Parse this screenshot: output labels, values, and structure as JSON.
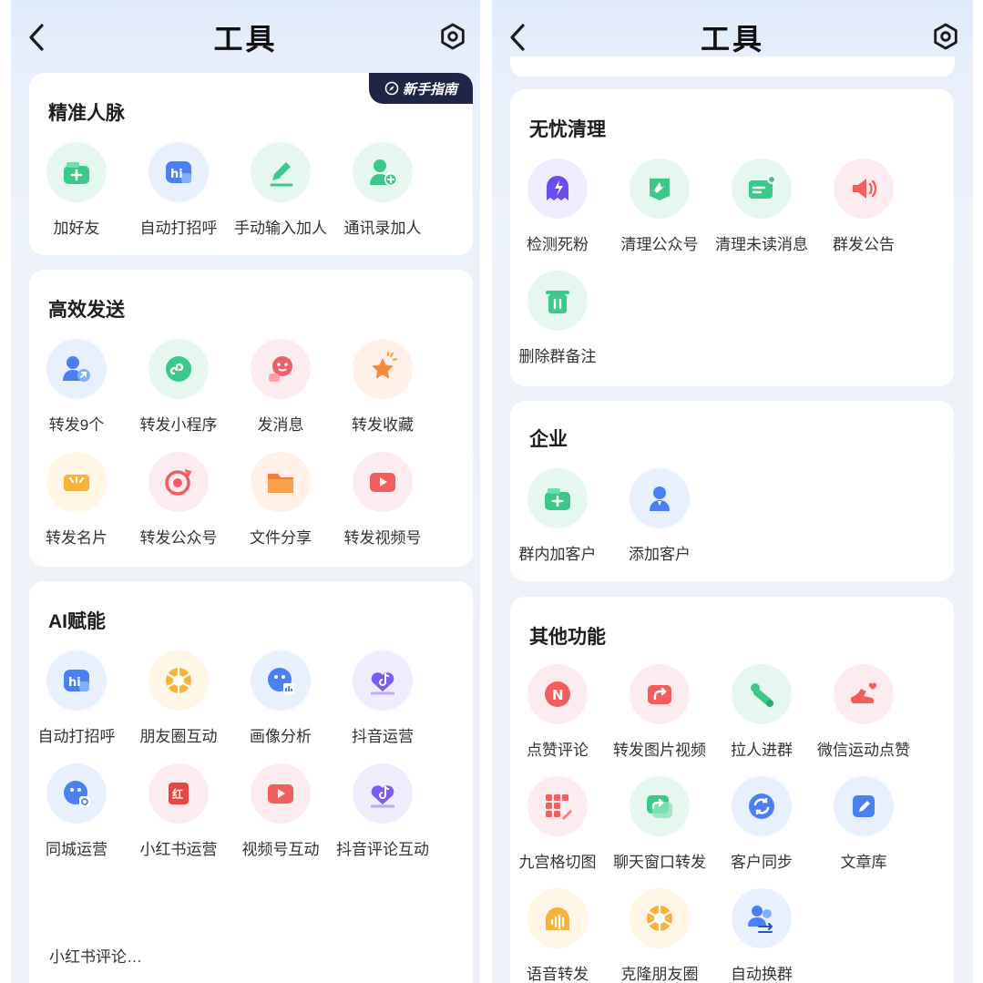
{
  "left": {
    "header": {
      "title": "工具"
    },
    "guide_badge": "新手指南",
    "sections": {
      "jingzhun": {
        "title": "精准人脉",
        "items": [
          "加好友",
          "自动打招呼",
          "手动输入加人",
          "通讯录加人"
        ]
      },
      "gaoxiao": {
        "title": "高效发送",
        "items": [
          "转发9个",
          "转发小程序",
          "发消息",
          "转发收藏",
          "转发名片",
          "转发公众号",
          "文件分享",
          "转发视频号"
        ]
      },
      "ai": {
        "title": "AI赋能",
        "items": [
          "自动打招呼",
          "朋友圈互动",
          "画像分析",
          "抖音运营",
          "同城运营",
          "小红书运营",
          "视频号互动",
          "抖音评论互动"
        ]
      }
    },
    "peek_text": "小红书评论…"
  },
  "right": {
    "header": {
      "title": "工具"
    },
    "sections": {
      "wuyou": {
        "title": "无忧清理",
        "items": [
          "检测死粉",
          "清理公众号",
          "清理未读消息",
          "群发公告",
          "删除群备注"
        ]
      },
      "qiye": {
        "title": "企业",
        "items": [
          "群内加客户",
          "添加客户"
        ]
      },
      "qita": {
        "title": "其他功能",
        "items": [
          "点赞评论",
          "转发图片视频",
          "拉人进群",
          "微信运动点赞",
          "九宫格切图",
          "聊天窗口转发",
          "客户同步",
          "文章库",
          "语音转发",
          "克隆朋友圈",
          "自动换群"
        ]
      }
    }
  },
  "icons": {
    "left": {
      "jingzhun": [
        "add-friend-icon",
        "greeting-hi-icon",
        "pencil-icon",
        "contacts-add-icon"
      ],
      "gaoxiao": [
        "forward-person-icon",
        "mini-program-icon",
        "message-face-icon",
        "star-icon",
        "business-card-icon",
        "official-account-icon",
        "folder-icon",
        "video-channel-icon"
      ],
      "ai": [
        "greeting-hi-icon",
        "aperture-icon",
        "portrait-analysis-icon",
        "douyin-icon",
        "local-city-icon",
        "xiaohongshu-icon",
        "video-channel-icon",
        "douyin-comment-icon"
      ]
    },
    "right": {
      "wuyou": [
        "lightning-ghost-icon",
        "flag-icon",
        "chat-box-icon",
        "megaphone-icon",
        "trash-icon"
      ],
      "qiye": [
        "add-customer-box-icon",
        "customer-person-icon"
      ],
      "qita": [
        "like-comment-n-icon",
        "forward-image-icon",
        "pull-group-icon",
        "sport-like-icon",
        "grid-cut-icon",
        "chat-forward-icon",
        "sync-icon",
        "article-edit-icon",
        "voice-icon",
        "aperture-icon",
        "switch-group-icon"
      ]
    }
  },
  "colors": {
    "green": "#3cc88a",
    "blue": "#4a8ff5",
    "red": "#f25d5d",
    "orange": "#f5a623",
    "purple": "#7b6cf0",
    "badge_bg": "#1f2545"
  }
}
